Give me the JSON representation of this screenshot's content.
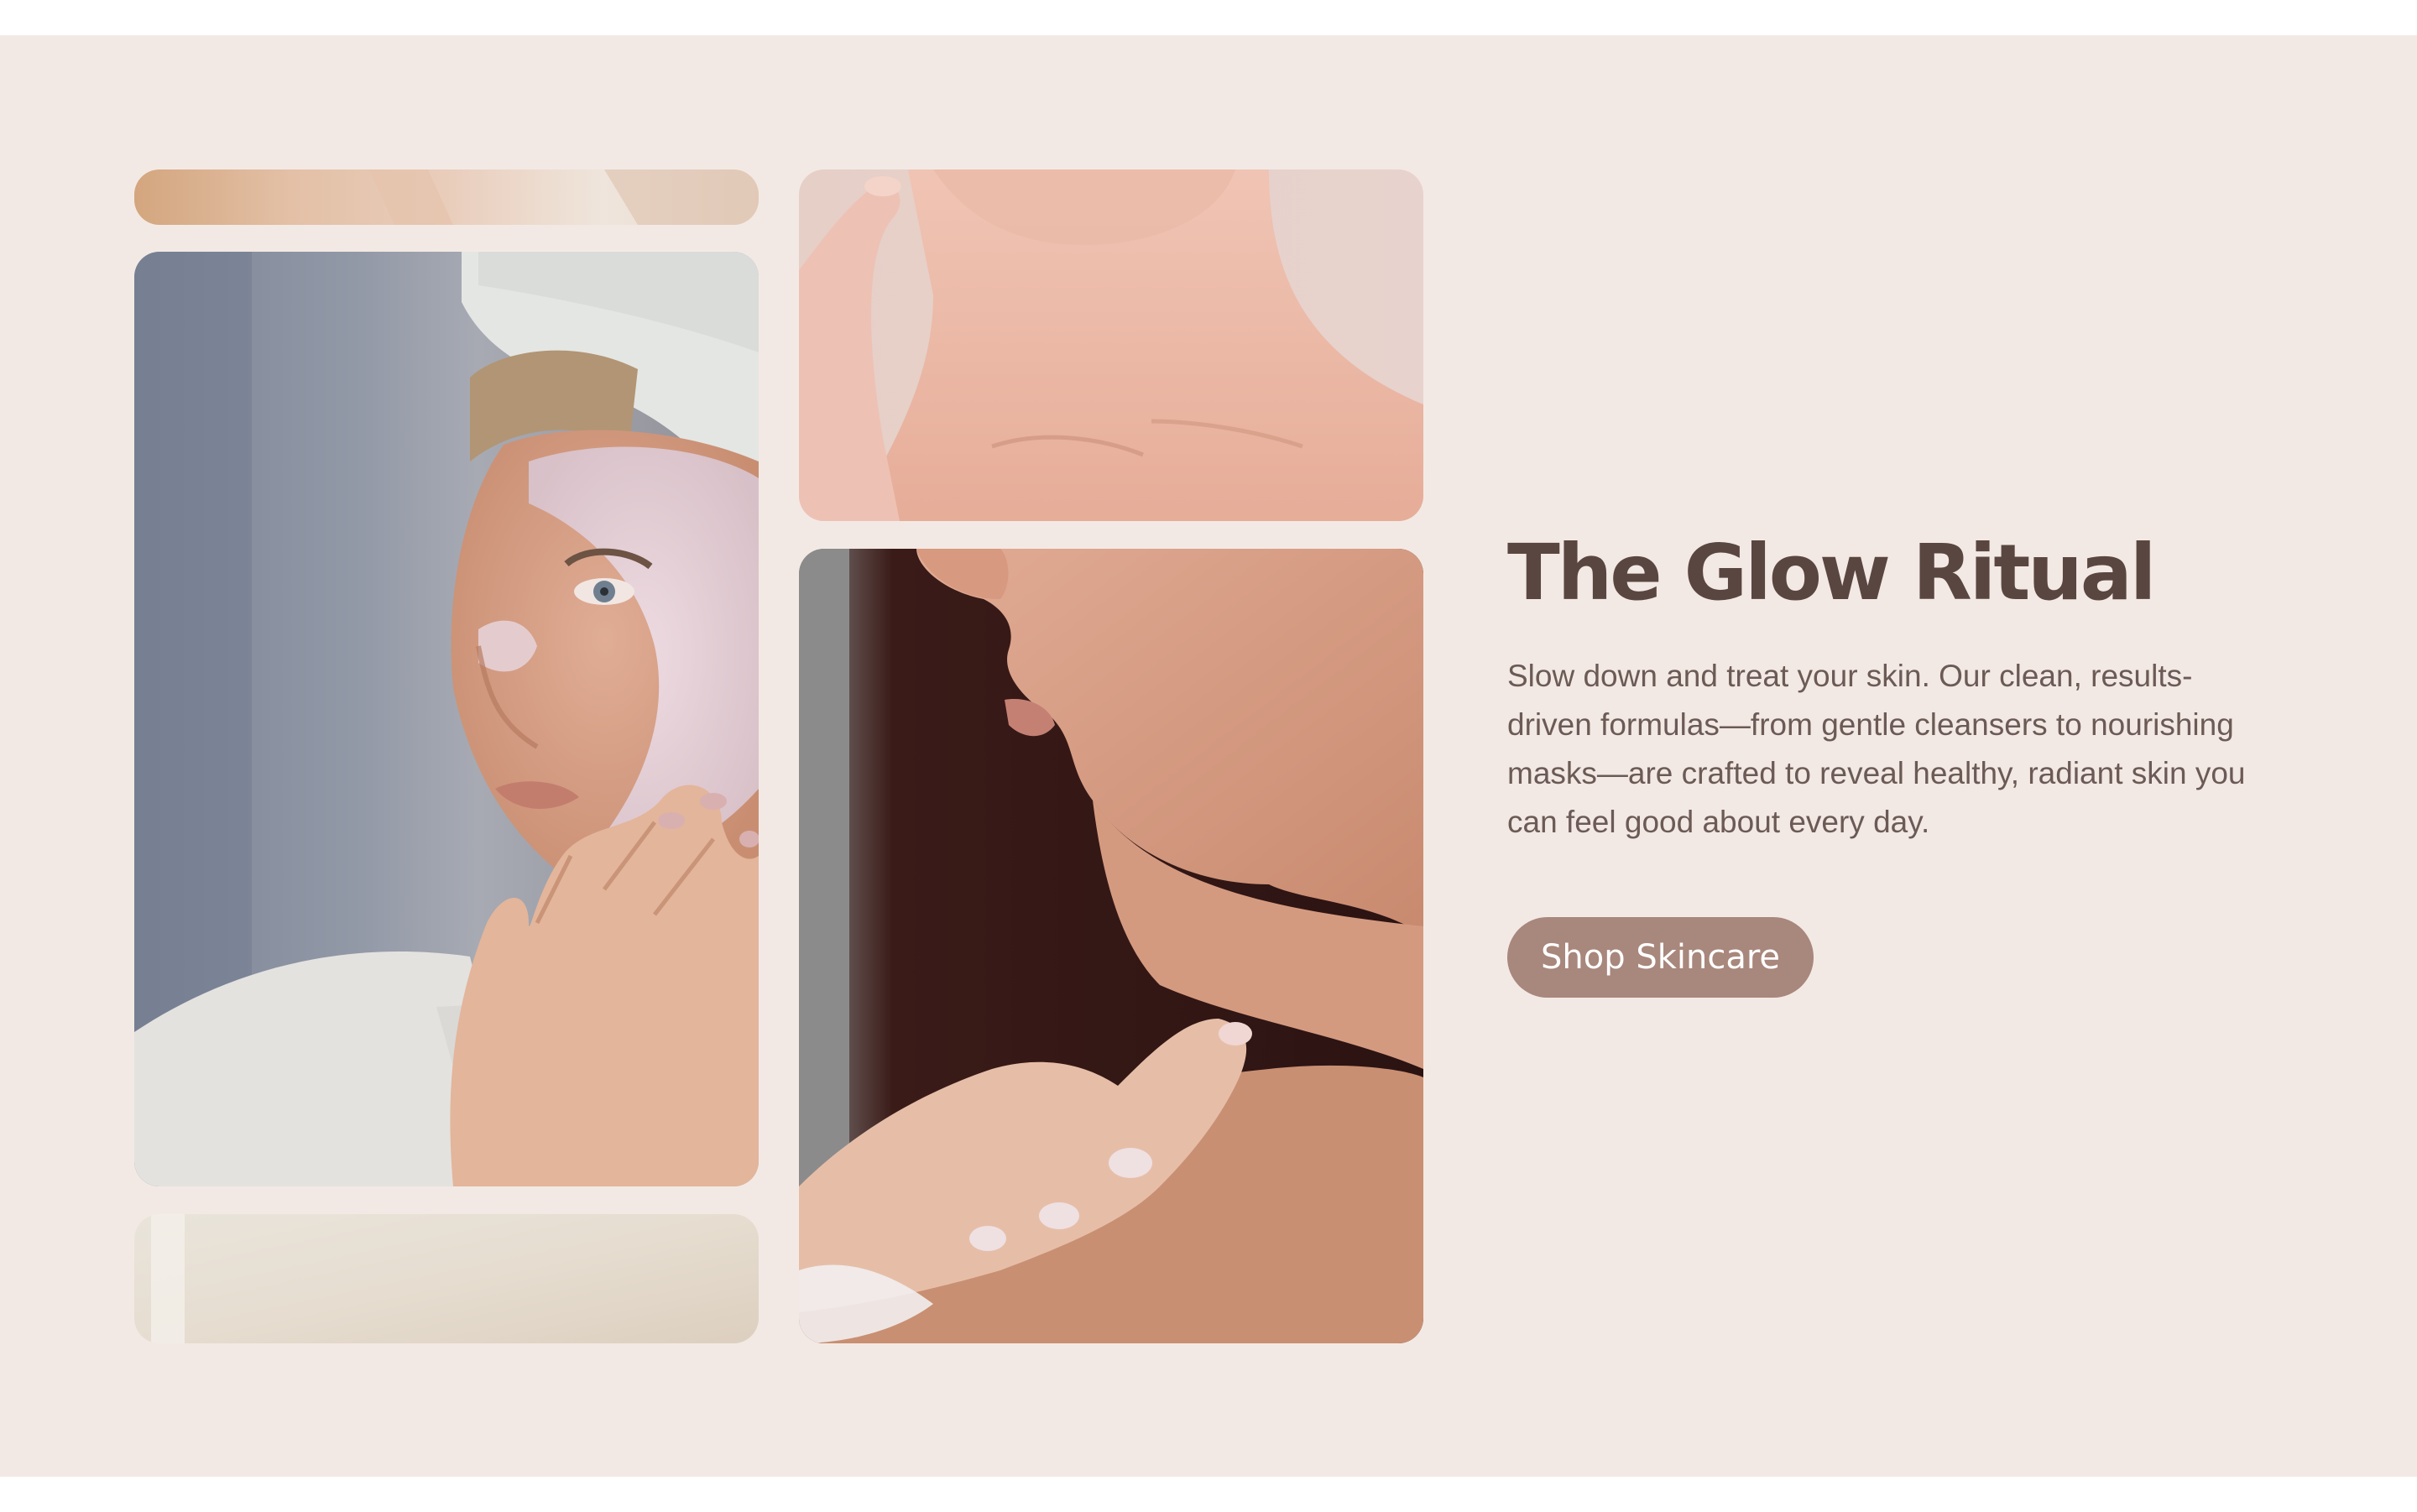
{
  "hero": {
    "title": "The Glow Ritual",
    "description": "Slow down and treat your skin. Our clean, results-driven formulas—from gentle cleansers to nourishing masks—are crafted to reveal healthy, radiant skin you can feel good about every day.",
    "cta_label": "Shop Skincare"
  },
  "colors": {
    "background": "#f3e9e4",
    "title": "#5a4640",
    "body": "#6b5a55",
    "button": "#a8877c",
    "button_text": "#ffffff"
  }
}
